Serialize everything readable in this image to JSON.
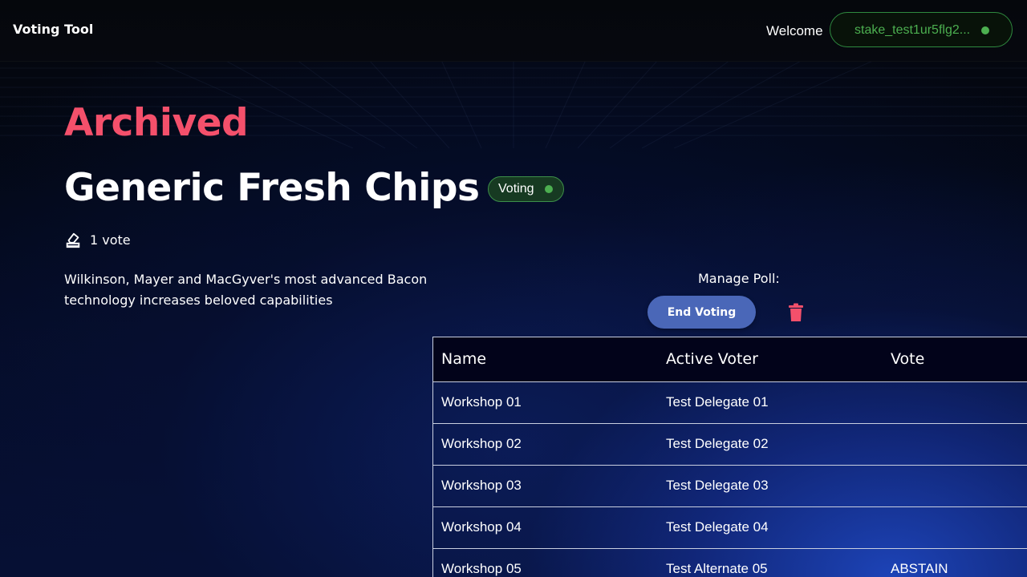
{
  "header": {
    "brand": "Voting Tool",
    "welcome": "Welcome",
    "wallet_address": "stake_test1ur5flg2...",
    "wallet_status_color": "#4caf50"
  },
  "poll": {
    "state_label": "Archived",
    "title": "Generic Fresh Chips",
    "status_badge": "Voting",
    "vote_count": "1 vote",
    "description": "Wilkinson, Mayer and MacGyver's most advanced Bacon technology increases beloved capabilities"
  },
  "manage": {
    "label": "Manage Poll:",
    "end_voting_label": "End Voting",
    "delete_icon": "trash-icon"
  },
  "table": {
    "headers": [
      "Name",
      "Active Voter",
      "Vote"
    ],
    "rows": [
      {
        "name": "Workshop 01",
        "voter": "Test Delegate 01",
        "vote": ""
      },
      {
        "name": "Workshop 02",
        "voter": "Test Delegate 02",
        "vote": ""
      },
      {
        "name": "Workshop 03",
        "voter": "Test Delegate 03",
        "vote": ""
      },
      {
        "name": "Workshop 04",
        "voter": "Test Delegate 04",
        "vote": ""
      },
      {
        "name": "Workshop 05",
        "voter": "Test Alternate 05",
        "vote": "ABSTAIN"
      }
    ]
  },
  "colors": {
    "accent_red": "#f4506b",
    "status_green": "#4caf50",
    "button_blue": "#4a67b8"
  }
}
